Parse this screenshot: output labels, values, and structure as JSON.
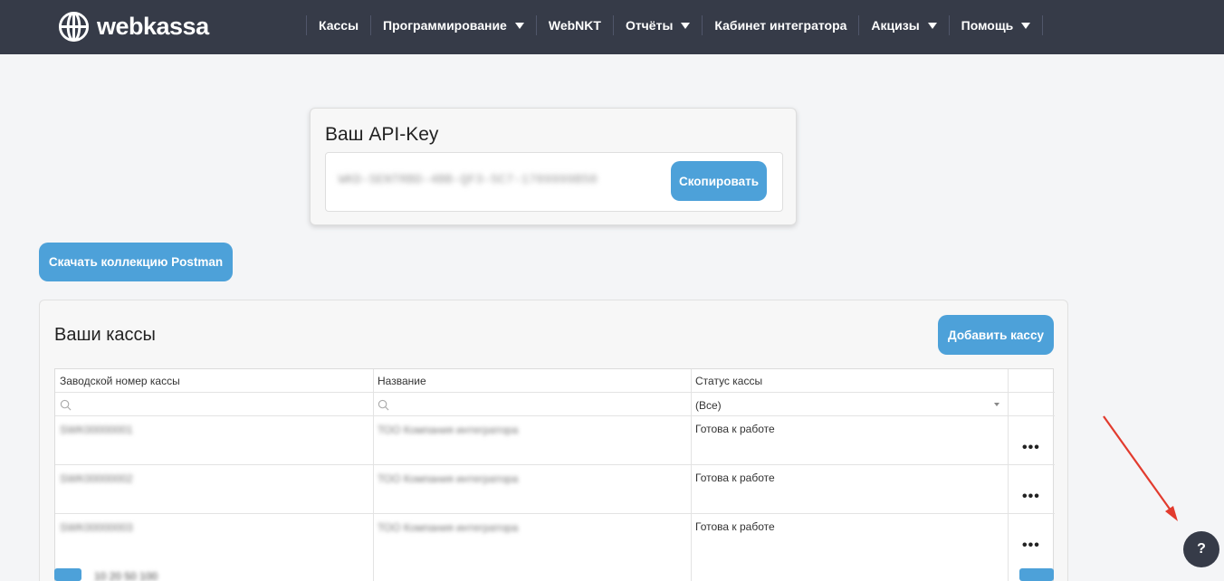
{
  "header": {
    "brand": "webkassa",
    "nav": [
      {
        "label": "Кассы",
        "dropdown": false
      },
      {
        "label": "Программирование",
        "dropdown": true
      },
      {
        "label": "WebNKT",
        "dropdown": false
      },
      {
        "label": "Отчёты",
        "dropdown": true
      },
      {
        "label": "Кабинет интегратора",
        "dropdown": false
      },
      {
        "label": "Акцизы",
        "dropdown": true
      },
      {
        "label": "Помощь",
        "dropdown": true
      }
    ]
  },
  "api_key": {
    "title": "Ваш API-Key",
    "value": "WKD-SENTRBD-4BB-QF3-5C7-1709999B50",
    "copy_label": "Скопировать"
  },
  "postman_button": "Скачать коллекцию Postman",
  "registers": {
    "title": "Ваши кассы",
    "add_label": "Добавить кассу",
    "columns": [
      "Заводской номер кассы",
      "Название",
      "Статус кассы"
    ],
    "status_filter": "(Все)",
    "rows": [
      {
        "serial": "SWK00000001",
        "name": "ТОО Компания интегратора",
        "status": "Готова к работе"
      },
      {
        "serial": "SWK00000002",
        "name": "ТОО Компания интегратора",
        "status": "Готова к работе"
      },
      {
        "serial": "SWK00000003",
        "name": "ТОО Компания интегратора",
        "status": "Готова к работе"
      }
    ],
    "actions_label": "•••",
    "pager_sizes": "10  20  50  100"
  },
  "help_label": "?",
  "colors": {
    "topbar": "#363b48",
    "accent": "#4da1d9",
    "background": "#f4f5f7",
    "annotation_arrow": "#e23b2e"
  }
}
